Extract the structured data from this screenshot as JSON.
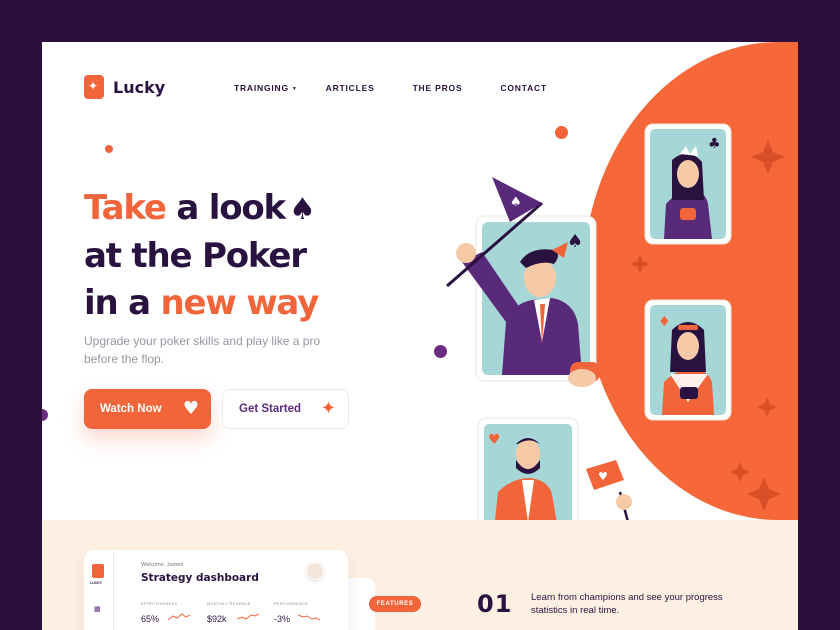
{
  "brand": {
    "name": "Lucky"
  },
  "nav": {
    "items": [
      {
        "label": "TRAINGING",
        "has_dropdown": true
      },
      {
        "label": "ARTICLES"
      },
      {
        "label": "THE PROS"
      },
      {
        "label": "CONTACT"
      }
    ]
  },
  "hero": {
    "title_line1_a": "Take",
    "title_line1_b": "a look",
    "title_line2": "at the Poker",
    "title_line3_a": "in a",
    "title_line3_b": "new way",
    "subtitle": "Upgrade your poker skills and play like a pro before the flop.",
    "watch_label": "Watch Now",
    "start_label": "Get Started"
  },
  "dashboard": {
    "brand_small": "LUCKY",
    "welcome": "Welcome, James",
    "title": "Strategy dashboard",
    "stats": [
      {
        "label": "EFFECTIVENESS",
        "value": "65%"
      },
      {
        "label": "MONTHLY REVENUE",
        "value": "$92k"
      },
      {
        "label": "PERFORMANCE",
        "value": "-3%"
      }
    ]
  },
  "features": {
    "badge": "FEATURES",
    "number": "01",
    "text": "Learn from champions and see your progress statistics in real time."
  },
  "colors": {
    "accent": "#f2643a",
    "dark": "#2a1240",
    "frame": "#2d0f3e",
    "cream": "#fdf0e2",
    "teal": "#a6d7d6",
    "purple": "#5a2a7a"
  }
}
